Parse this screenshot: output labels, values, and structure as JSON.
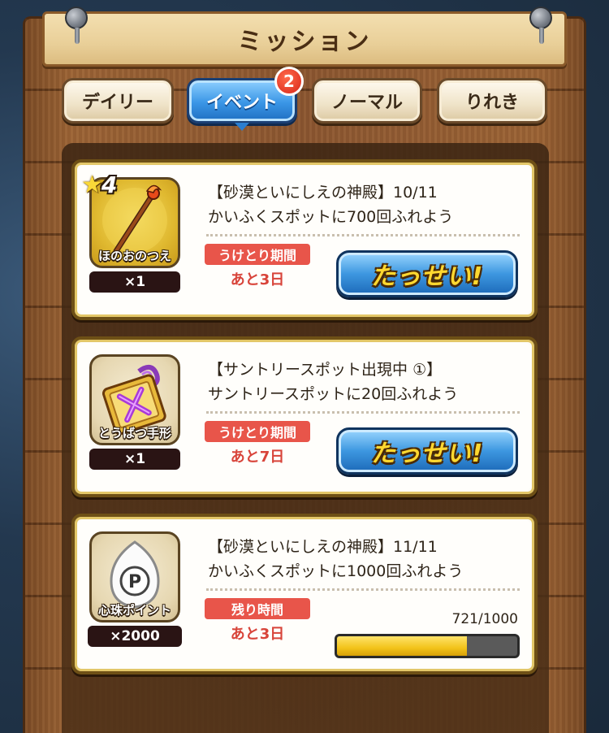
{
  "header": {
    "title": "ミッション"
  },
  "tabs": [
    {
      "label": "デイリー",
      "active": false
    },
    {
      "label": "イベント",
      "active": true,
      "badge": "2"
    },
    {
      "label": "ノーマル",
      "active": false
    },
    {
      "label": "りれき",
      "active": false
    }
  ],
  "missions": [
    {
      "reward_name": "ほのおのつえ",
      "reward_qty": "×1",
      "rarity": "4",
      "icon": "staff-icon",
      "title_line1": "【砂漠といにしえの神殿】10/11",
      "title_line2": "かいふくスポットに700回ふれよう",
      "period_label": "うけとり期間",
      "remaining": "あと3日",
      "action_label": "たっせい!"
    },
    {
      "reward_name": "とうばつ手形",
      "reward_qty": "×1",
      "icon": "ticket-icon",
      "title_line1": "【サントリースポット出現中 ①】",
      "title_line2": "サントリースポットに20回ふれよう",
      "period_label": "うけとり期間",
      "remaining": "あと7日",
      "action_label": "たっせい!"
    },
    {
      "reward_name": "心珠ポイント",
      "reward_qty": "×2000",
      "icon": "p-orb-icon",
      "title_line1": "【砂漠といにしえの神殿】11/11",
      "title_line2": "かいふくスポットに1000回ふれよう",
      "period_label": "残り時間",
      "remaining": "あと3日",
      "progress_text": "721/1000",
      "progress_fraction": 0.721
    }
  ],
  "colors": {
    "accent_blue": "#3a96e6",
    "tag_red": "#e8554a",
    "progress_yellow": "#f2c31a"
  }
}
